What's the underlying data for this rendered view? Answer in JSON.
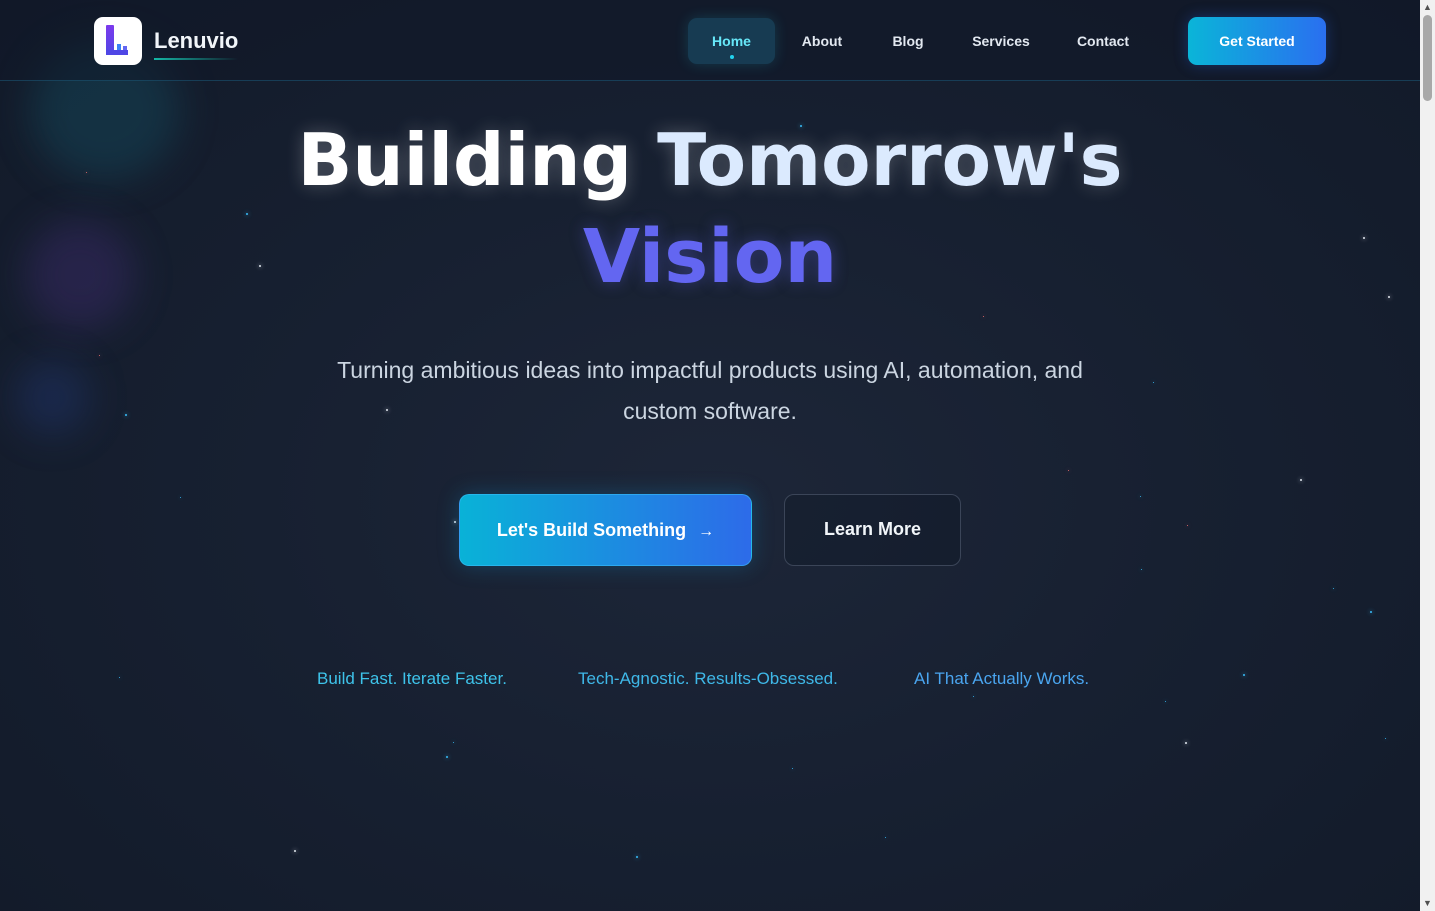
{
  "header": {
    "brand": "Lenuvio",
    "nav": [
      {
        "label": "Home",
        "active": true
      },
      {
        "label": "About",
        "active": false
      },
      {
        "label": "Blog",
        "active": false
      },
      {
        "label": "Services",
        "active": false
      },
      {
        "label": "Contact",
        "active": false
      }
    ],
    "cta_label": "Get Started"
  },
  "hero": {
    "title_line1_word1": "Building",
    "title_line1_word2": "Tomorrow's",
    "title_line2": "Vision",
    "subtitle": "Turning ambitious ideas into impactful products using AI, automation, and custom software.",
    "primary_button": "Let's Build Something",
    "primary_button_icon": "arrow-right-icon",
    "secondary_button": "Learn More"
  },
  "taglines": [
    "Build Fast. Iterate Faster.",
    "Tech-Agnostic. Results-Obsessed.",
    "AI That Actually Works."
  ],
  "colors": {
    "accent_cyan": "#22d3ee",
    "accent_indigo": "#6366f1",
    "cta_gradient_start": "#0ab5d8",
    "cta_gradient_end": "#2a6ff0",
    "background": "#172031"
  }
}
